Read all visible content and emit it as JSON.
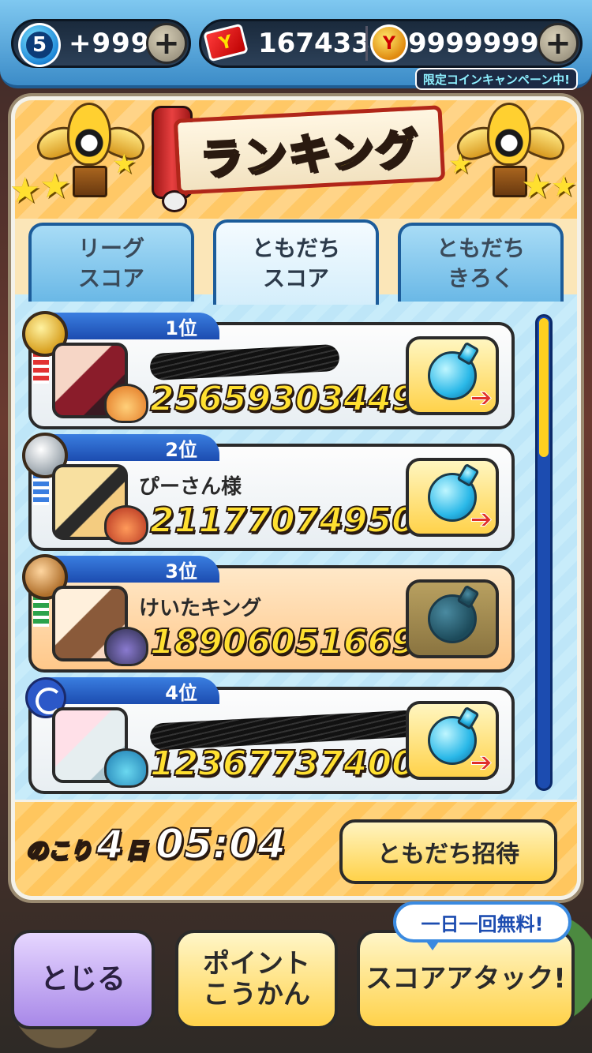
{
  "status_bar": {
    "stamina_level": "5",
    "stamina_value": "+999",
    "ticket_value": "167433",
    "coin_value": "9999999",
    "plus_label": "+",
    "campaign_label": "限定コインキャンペーン中!"
  },
  "panel": {
    "title": "ランキング",
    "tabs": [
      {
        "label": "リーグ\nスコア",
        "active": false
      },
      {
        "label": "ともだち\nスコア",
        "active": true
      },
      {
        "label": "ともだち\nきろく",
        "active": false
      }
    ]
  },
  "ranking": [
    {
      "rank": "1位",
      "name": "",
      "name_hidden": true,
      "score": "25659303449",
      "medal": "gold",
      "attack_enabled": true
    },
    {
      "rank": "2位",
      "name": "ぴーさん様",
      "name_hidden": false,
      "score": "21177074950",
      "medal": "silver",
      "attack_enabled": true
    },
    {
      "rank": "3位",
      "name": "けいたキング",
      "name_hidden": false,
      "score": "18906051669",
      "medal": "bronze",
      "attack_enabled": false,
      "is_me": true
    },
    {
      "rank": "4位",
      "name": "",
      "name_hidden": true,
      "score": "12367737400",
      "medal": "swirl",
      "attack_enabled": true
    }
  ],
  "footer": {
    "remaining_label": "のこり",
    "remaining_days": "4",
    "days_unit": "日",
    "remaining_time": "05:04",
    "invite_label": "ともだち招待"
  },
  "bottom": {
    "close_label": "とじる",
    "points_label": "ポイント\nこうかん",
    "score_attack_label": "スコアアタック!",
    "free_badge": "一日一回無料!"
  },
  "colors": {
    "score_yellow": "#ffe030",
    "tab_blue": "#1c5c9a",
    "rank_blue": "#1c4cb0",
    "button_yellow": "#ffd24a",
    "close_purple": "#a888e8"
  },
  "icons": [
    "stamina-drop-icon",
    "ticket-icon",
    "coin-purse-icon",
    "plus-icon",
    "trophy-icon",
    "star-icon",
    "medal-icon",
    "bomb-icon",
    "arrow-icon"
  ]
}
